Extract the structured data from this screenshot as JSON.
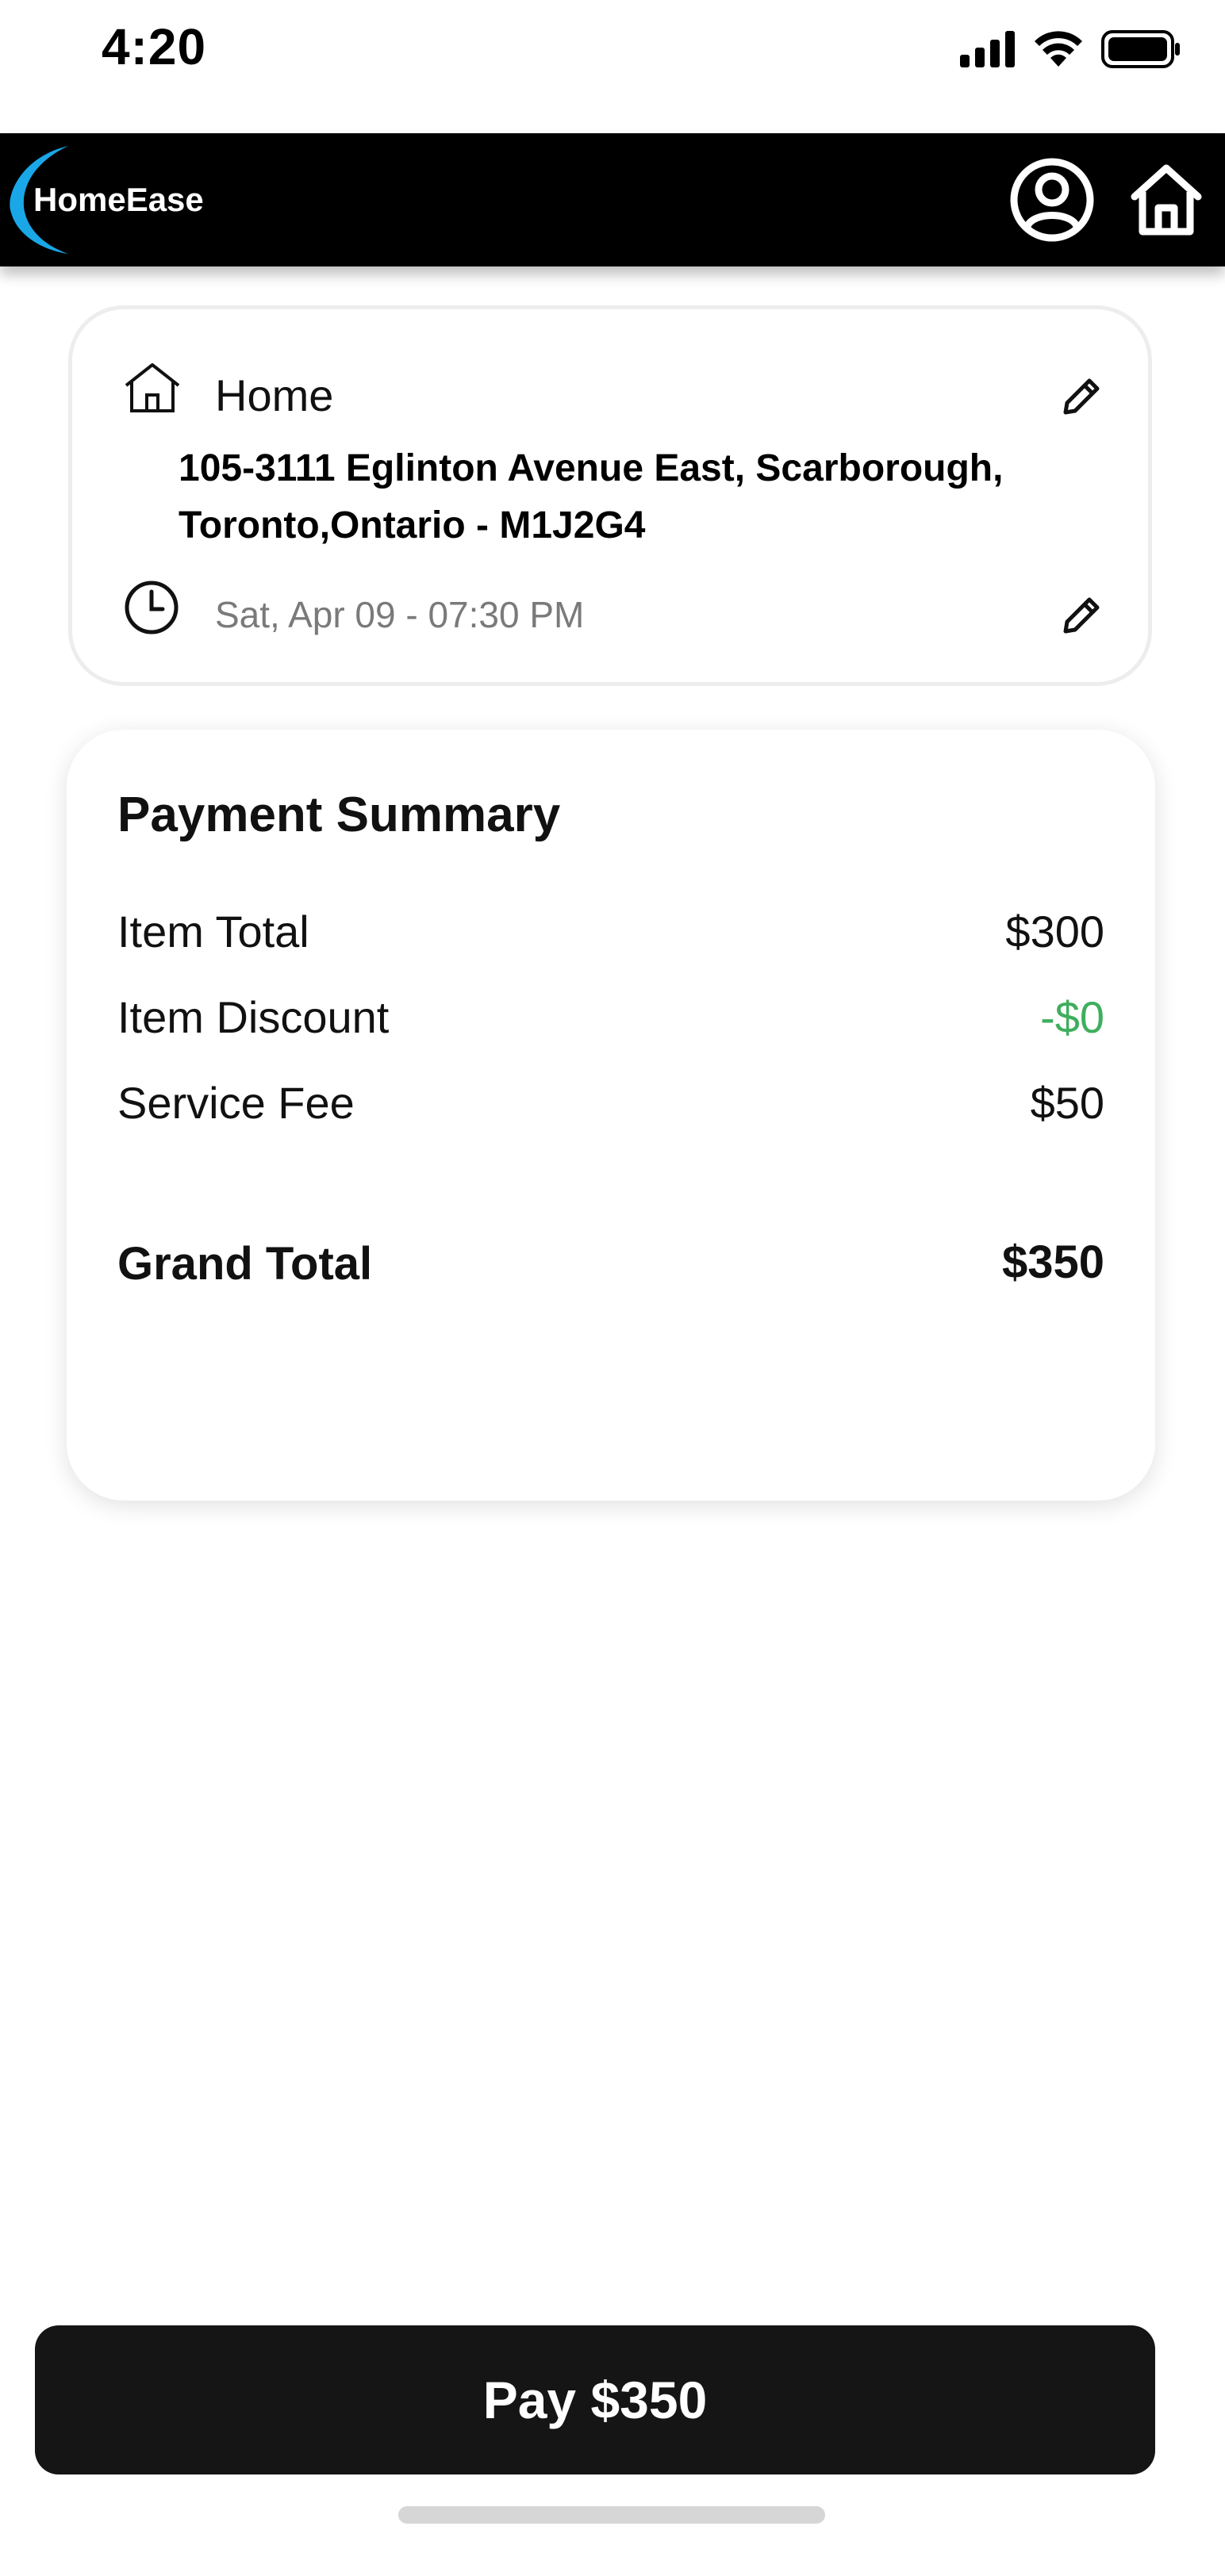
{
  "status_bar": {
    "time": "4:20",
    "icons": [
      "signal-icon",
      "wifi-icon",
      "battery-icon"
    ]
  },
  "header": {
    "brand": "HomeEase",
    "accent_color": "#1aa7e8",
    "icons": [
      "profile-icon",
      "home-icon"
    ]
  },
  "address_card": {
    "label": "Home",
    "address": "105-3111 Eglinton  Avenue East, Scarborough, Toronto,Ontario - M1J2G4",
    "schedule": "Sat, Apr 09 - 07:30 PM",
    "icons": [
      "house-icon",
      "clock-icon",
      "pencil-icon"
    ]
  },
  "payment_summary": {
    "title": "Payment Summary",
    "item_total_label": "Item Total",
    "item_total_value": "$300",
    "discount_label": "Item Discount",
    "discount_value": "-$0",
    "discount_color": "#3fae5d",
    "service_fee_label": "Service Fee",
    "service_fee_value": "$50",
    "grand_total_label": "Grand Total",
    "grand_total_value": "$350"
  },
  "pay_button": {
    "label": "Pay $350"
  }
}
